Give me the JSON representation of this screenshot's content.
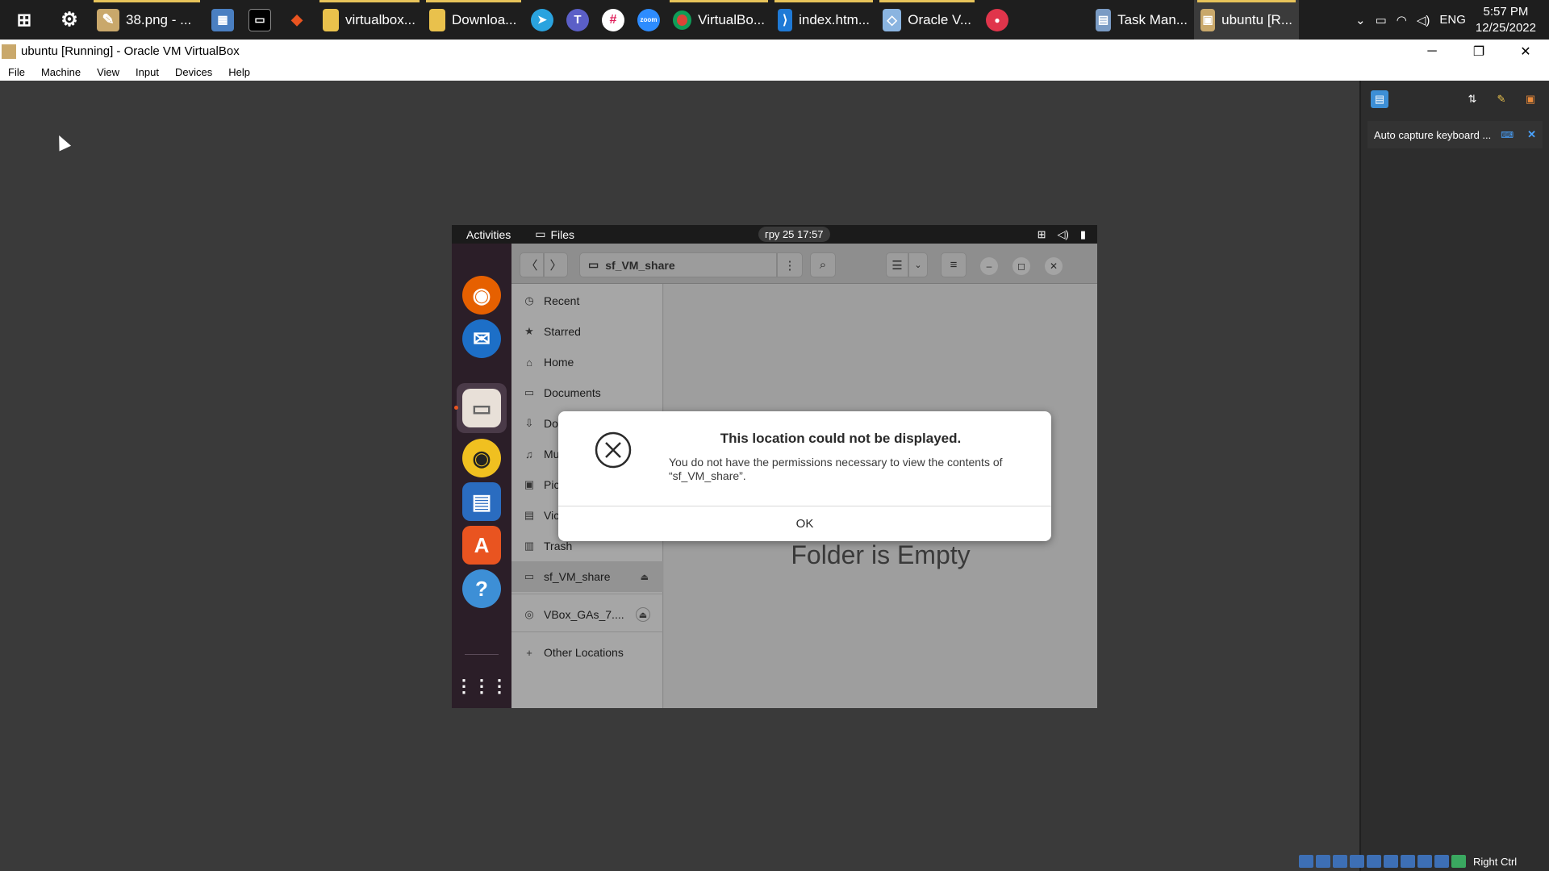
{
  "taskbar": {
    "apps": [
      {
        "name": "paint-38",
        "label": "38.png - ..."
      },
      {
        "name": "virtualbox-folder",
        "label": "virtualbox..."
      },
      {
        "name": "downloads-folder",
        "label": "Downloa..."
      },
      {
        "name": "chrome",
        "label": "VirtualBo..."
      },
      {
        "name": "vscode",
        "label": "index.htm..."
      },
      {
        "name": "oracle-vm",
        "label": "Oracle V..."
      },
      {
        "name": "task-manager",
        "label": "Task Man..."
      },
      {
        "name": "ubuntu-vm",
        "label": "ubuntu [R..."
      }
    ],
    "tray": {
      "lang": "ENG",
      "time": "5:57 PM",
      "date": "12/25/2022"
    }
  },
  "vbox": {
    "title": "ubuntu [Running] - Oracle VM VirtualBox",
    "menu": [
      "File",
      "Machine",
      "View",
      "Input",
      "Devices",
      "Help"
    ],
    "capture_text": "Auto capture keyboard ...",
    "host_key": "Right Ctrl"
  },
  "ubuntu": {
    "activities": "Activities",
    "files_label": "Files",
    "clock": "гру 25  17:57"
  },
  "nautilus": {
    "path": "sf_VM_share",
    "sidebar": [
      {
        "icon": "clock-icon",
        "glyph": "◷",
        "label": "Recent"
      },
      {
        "icon": "star-icon",
        "glyph": "★",
        "label": "Starred"
      },
      {
        "icon": "home-icon",
        "glyph": "⌂",
        "label": "Home"
      },
      {
        "icon": "documents-icon",
        "glyph": "▭",
        "label": "Documents"
      },
      {
        "icon": "downloads-icon",
        "glyph": "⇩",
        "label": "Do"
      },
      {
        "icon": "music-icon",
        "glyph": "♫",
        "label": "Mu"
      },
      {
        "icon": "pictures-icon",
        "glyph": "▣",
        "label": "Pic"
      },
      {
        "icon": "videos-icon",
        "glyph": "▤",
        "label": "Vic"
      },
      {
        "icon": "trash-icon",
        "glyph": "▥",
        "label": "Trash"
      },
      {
        "icon": "drive-icon",
        "glyph": "▭",
        "label": "sf_VM_share"
      },
      {
        "icon": "disc-icon",
        "glyph": "◎",
        "label": "VBox_GAs_7...."
      },
      {
        "icon": "plus-icon",
        "glyph": "+",
        "label": "Other Locations"
      }
    ],
    "empty_text": "Folder is Empty"
  },
  "dialog": {
    "title": "This location could not be displayed.",
    "message_line1": "You do not have the permissions necessary to view the contents of",
    "message_line2": "“sf_VM_share”.",
    "ok": "OK"
  }
}
